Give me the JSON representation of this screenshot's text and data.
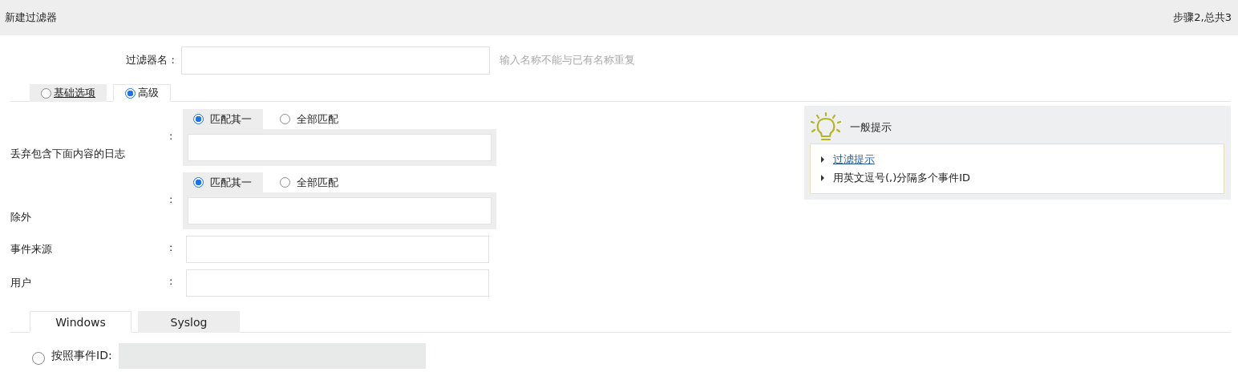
{
  "header": {
    "title": "新建过滤器",
    "step": "步骤2,总共3"
  },
  "name_field": {
    "label": "过滤器名 :",
    "hint": "输入名称不能与已有名称重复"
  },
  "mode_tabs": [
    {
      "label": "基础选项",
      "selected": false
    },
    {
      "label": "高级",
      "selected": true
    }
  ],
  "rules": [
    {
      "label": "丢弃包含下面内容的日志",
      "colon": ":",
      "options": [
        {
          "label": "匹配其一",
          "selected": true
        },
        {
          "label": "全部匹配",
          "selected": false
        }
      ]
    },
    {
      "label": "除外",
      "colon": ":",
      "options": [
        {
          "label": "匹配其一",
          "selected": true
        },
        {
          "label": "全部匹配",
          "selected": false
        }
      ]
    }
  ],
  "fields": [
    {
      "label": "事件来源",
      "colon": ":"
    },
    {
      "label": "用户",
      "colon": ":"
    }
  ],
  "tips": {
    "title": "一般提示",
    "items": [
      {
        "kind": "link",
        "text": "过滤提示"
      },
      {
        "kind": "text",
        "text": "用英文逗号(,)分隔多个事件ID"
      }
    ]
  },
  "source_tabs": [
    {
      "label": "Windows",
      "selected": true
    },
    {
      "label": "Syslog",
      "selected": false
    }
  ],
  "event_id": {
    "label": "按照事件ID:",
    "selected": false,
    "disabled": true
  }
}
